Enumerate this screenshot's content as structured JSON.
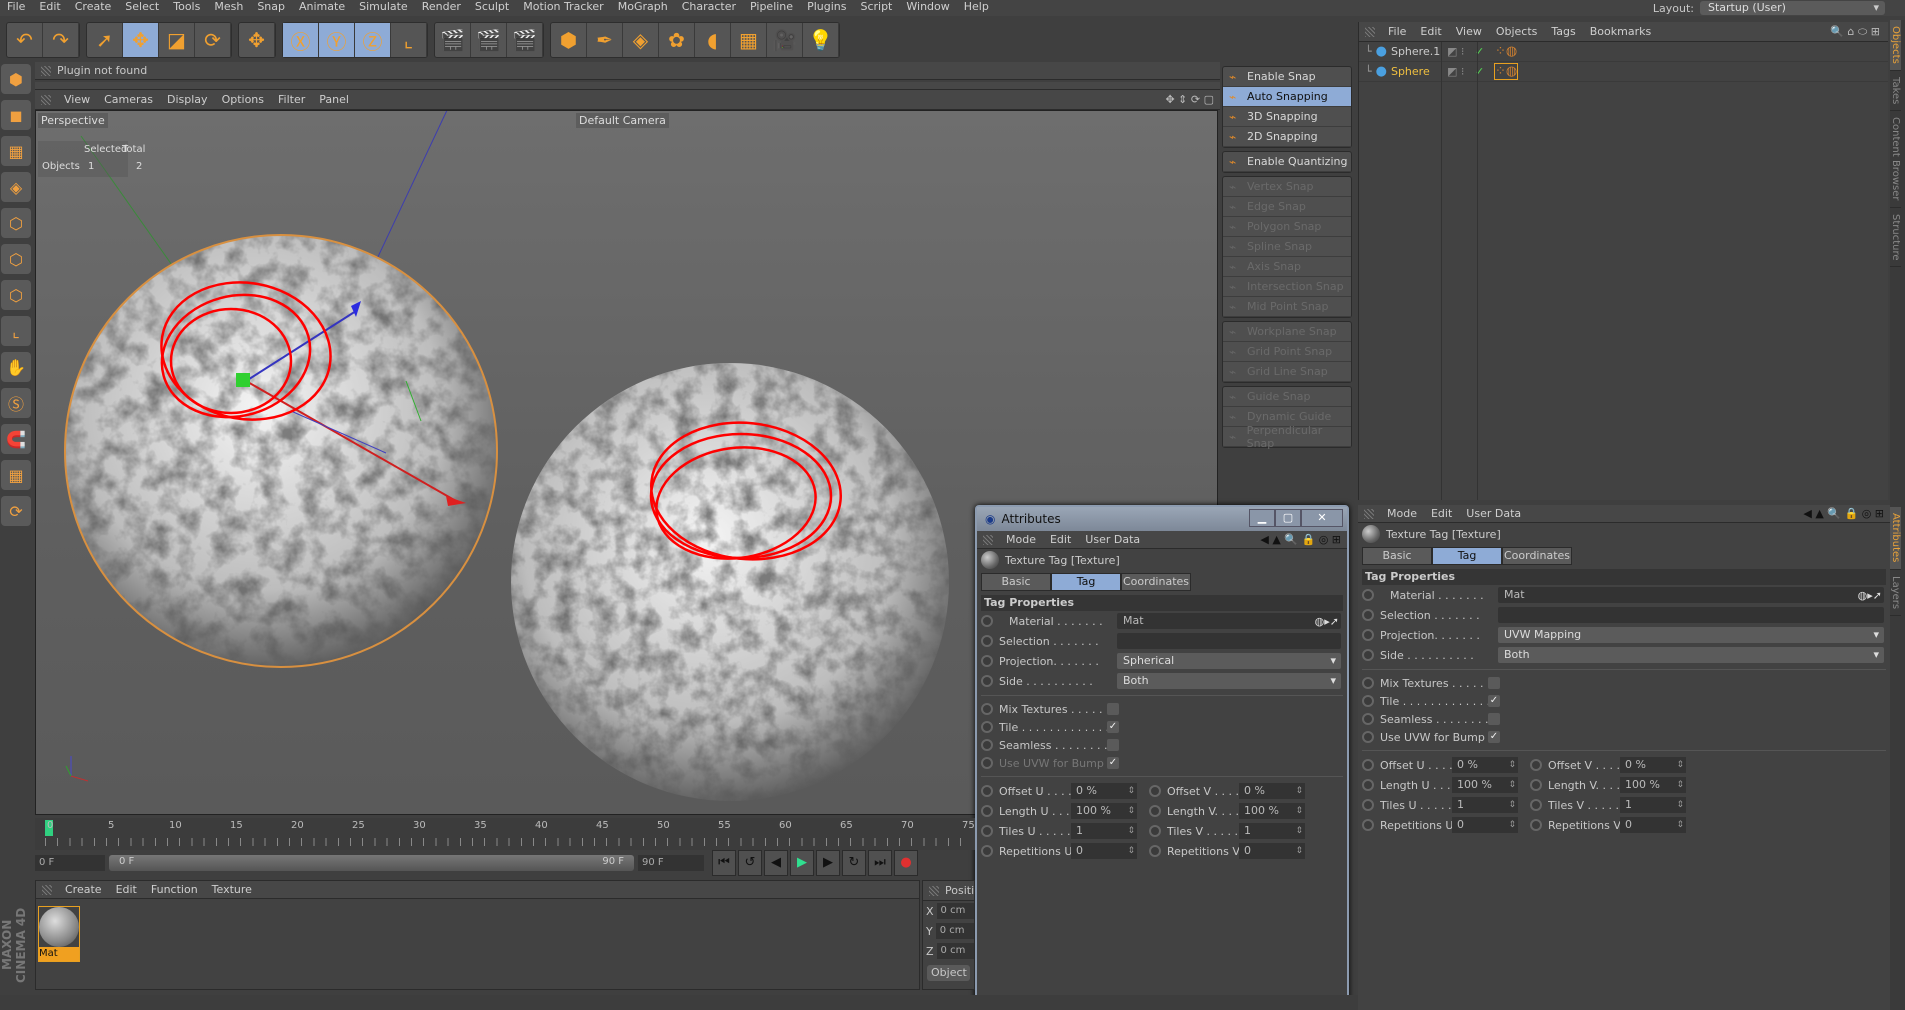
{
  "menu": [
    "File",
    "Edit",
    "Create",
    "Select",
    "Tools",
    "Mesh",
    "Snap",
    "Animate",
    "Simulate",
    "Render",
    "Sculpt",
    "Motion Tracker",
    "MoGraph",
    "Character",
    "Pipeline",
    "Plugins",
    "Script",
    "Window",
    "Help"
  ],
  "layout": {
    "label": "Layout:",
    "value": "Startup (User)"
  },
  "toolbar": [
    {
      "group": [
        {
          "icon": "undo-icon",
          "glyph": "↶"
        },
        {
          "icon": "redo-icon",
          "glyph": "↷"
        }
      ]
    },
    {
      "group": [
        {
          "icon": "live-selection-icon",
          "glyph": "➚"
        },
        {
          "icon": "move-icon",
          "glyph": "✥",
          "active": true
        },
        {
          "icon": "scale-icon",
          "glyph": "◪"
        },
        {
          "icon": "rotate-icon",
          "glyph": "⟳"
        }
      ]
    },
    {
      "group": [
        {
          "icon": "recent-tool-icon",
          "glyph": "✥"
        }
      ]
    },
    {
      "group": [
        {
          "icon": "x-axis-icon",
          "glyph": "Ⓧ",
          "active": true
        },
        {
          "icon": "y-axis-icon",
          "glyph": "Ⓨ",
          "active": true
        },
        {
          "icon": "z-axis-icon",
          "glyph": "Ⓩ",
          "active": true
        },
        {
          "icon": "coordinate-system-icon",
          "glyph": "⌞"
        }
      ]
    },
    {
      "group": [
        {
          "icon": "render-view-icon",
          "glyph": "🎬"
        },
        {
          "icon": "render-picture-viewer-icon",
          "glyph": "🎬"
        },
        {
          "icon": "render-settings-icon",
          "glyph": "🎬"
        }
      ]
    },
    {
      "group": [
        {
          "icon": "cube-icon",
          "glyph": "⬢"
        },
        {
          "icon": "pen-icon",
          "glyph": "✒"
        },
        {
          "icon": "subdivision-icon",
          "glyph": "◈"
        },
        {
          "icon": "cloner-icon",
          "glyph": "✿"
        },
        {
          "icon": "deformer-icon",
          "glyph": "◖"
        },
        {
          "icon": "floor-icon",
          "glyph": "▦"
        },
        {
          "icon": "camera-icon",
          "glyph": "🎥"
        },
        {
          "icon": "light-icon",
          "glyph": "💡"
        }
      ]
    }
  ],
  "left_tools": [
    "make-editable-icon",
    "model-mode-icon",
    "texture-mode-icon",
    "workplane-icon",
    "points-mode-icon",
    "edges-mode-icon",
    "polygons-mode-icon",
    "axis-mode-icon",
    "tweak-icon",
    "solo-icon",
    "snap-icon",
    "lock-workplane-icon",
    "quantize-icon"
  ],
  "status_bar": "Plugin not found",
  "viewport": {
    "menu": [
      "View",
      "Cameras",
      "Display",
      "Options",
      "Filter",
      "Panel"
    ],
    "view_name": "Perspective",
    "camera": "Default Camera",
    "hud": {
      "selected": "Selected",
      "total": "Total",
      "row_label": "Objects",
      "selected_value": "1",
      "total_value": "2"
    }
  },
  "snap_menu": [
    [
      {
        "label": "Enable Snap",
        "enabled": true
      },
      {
        "label": "Auto Snapping",
        "enabled": true,
        "highlight": true
      },
      {
        "label": "3D Snapping",
        "enabled": true
      },
      {
        "label": "2D Snapping",
        "enabled": true
      }
    ],
    [
      {
        "label": "Enable Quantizing",
        "enabled": true
      }
    ],
    [
      {
        "label": "Vertex Snap"
      },
      {
        "label": "Edge Snap"
      },
      {
        "label": "Polygon Snap"
      },
      {
        "label": "Spline Snap"
      },
      {
        "label": "Axis Snap"
      },
      {
        "label": "Intersection Snap"
      },
      {
        "label": "Mid Point Snap"
      }
    ],
    [
      {
        "label": "Workplane Snap"
      },
      {
        "label": "Grid Point Snap"
      },
      {
        "label": "Grid Line Snap"
      }
    ],
    [
      {
        "label": "Guide Snap"
      },
      {
        "label": "Dynamic Guide"
      },
      {
        "label": "Perpendicular Snap"
      }
    ]
  ],
  "object_manager": {
    "menu": [
      "File",
      "Edit",
      "View",
      "Objects",
      "Tags",
      "Bookmarks"
    ],
    "objects": [
      {
        "name": "Sphere.1",
        "selected": false
      },
      {
        "name": "Sphere",
        "selected": true
      }
    ]
  },
  "side_tabs_top": [
    "Objects",
    "Takes",
    "Content Browser",
    "Structure"
  ],
  "side_tabs_bottom": [
    "Attributes",
    "Layers"
  ],
  "attributes_floating": {
    "window_title": "Attributes",
    "menu": [
      "Mode",
      "Edit",
      "User Data"
    ],
    "object_title": "Texture Tag [Texture]",
    "tabs": [
      "Basic",
      "Tag",
      "Coordinates"
    ],
    "active_tab": "Tag",
    "section": "Tag Properties",
    "material": {
      "label": "Material . . . . . . .",
      "value": "Mat"
    },
    "selection": {
      "label": "Selection . . . . . . .",
      "value": ""
    },
    "projection": {
      "label": "Projection. . . . . . .",
      "value": "Spherical"
    },
    "side": {
      "label": "Side . . . . . . . . . .",
      "value": "Both"
    },
    "checks": [
      {
        "label": "Mix Textures . . . . .",
        "checked": false
      },
      {
        "label": "Tile . . . . . . . . . . . . .",
        "checked": true
      },
      {
        "label": "Seamless . . . . . . . .",
        "checked": false
      },
      {
        "label": "Use UVW for Bump",
        "checked": true,
        "disabled": true
      }
    ],
    "numeric": [
      [
        {
          "label": "Offset U . . . .",
          "value": "0 %"
        },
        {
          "label": "Offset V . . . .",
          "value": "0 %"
        }
      ],
      [
        {
          "label": "Length U . . .",
          "value": "100 %"
        },
        {
          "label": "Length V. . . .",
          "value": "100 %"
        }
      ],
      [
        {
          "label": "Tiles U . . . . .",
          "value": "1"
        },
        {
          "label": "Tiles V . . . . .",
          "value": "1"
        }
      ],
      [
        {
          "label": "Repetitions U",
          "value": "0"
        },
        {
          "label": "Repetitions V",
          "value": "0"
        }
      ]
    ]
  },
  "attributes_docked": {
    "menu": [
      "Mode",
      "Edit",
      "User Data"
    ],
    "object_title": "Texture Tag [Texture]",
    "tabs": [
      "Basic",
      "Tag",
      "Coordinates"
    ],
    "active_tab": "Tag",
    "section": "Tag Properties",
    "material": {
      "label": "Material . . . . . . .",
      "value": "Mat"
    },
    "selection": {
      "label": "Selection . . . . . . .",
      "value": ""
    },
    "projection": {
      "label": "Projection. . . . . . .",
      "value": "UVW Mapping"
    },
    "side": {
      "label": "Side . . . . . . . . . .",
      "value": "Both"
    },
    "checks": [
      {
        "label": "Mix Textures . . . . .",
        "checked": false
      },
      {
        "label": "Tile . . . . . . . . . . . . .",
        "checked": true
      },
      {
        "label": "Seamless . . . . . . . .",
        "checked": false
      },
      {
        "label": "Use UVW for Bump",
        "checked": true
      }
    ],
    "numeric": [
      [
        {
          "label": "Offset U . . . .",
          "value": "0 %"
        },
        {
          "label": "Offset V . . . .",
          "value": "0 %"
        }
      ],
      [
        {
          "label": "Length U . . .",
          "value": "100 %"
        },
        {
          "label": "Length V. . . .",
          "value": "100 %"
        }
      ],
      [
        {
          "label": "Tiles U . . . . .",
          "value": "1"
        },
        {
          "label": "Tiles V . . . . .",
          "value": "1"
        }
      ],
      [
        {
          "label": "Repetitions U",
          "value": "0"
        },
        {
          "label": "Repetitions V",
          "value": "0"
        }
      ]
    ]
  },
  "timeline": {
    "ticks": [
      "0",
      "5",
      "10",
      "15",
      "20",
      "25",
      "30",
      "35",
      "40",
      "45",
      "50",
      "55",
      "60",
      "65",
      "70",
      "75"
    ],
    "current_frame": "0 F",
    "range_start": "0 F",
    "range_end": "90 F",
    "end_frame": "90 F",
    "controls": [
      "go-to-start-icon",
      "previous-key-icon",
      "step-back-icon",
      "play-icon",
      "step-forward-icon",
      "next-key-icon",
      "go-to-end-icon",
      "record-icon"
    ]
  },
  "material_manager": {
    "menu": [
      "Create",
      "Edit",
      "Function",
      "Texture"
    ],
    "materials": [
      {
        "name": "Mat"
      }
    ]
  },
  "coordinates": {
    "title": "Position",
    "rows": [
      {
        "axis": "X",
        "value": "0 cm"
      },
      {
        "axis": "Y",
        "value": "0 cm"
      },
      {
        "axis": "Z",
        "value": "0 cm"
      }
    ],
    "button": "Object"
  },
  "brand": "MAXON CINEMA 4D",
  "colors": {
    "highlight": "#8eabd6",
    "selected_object": "#f0c040",
    "annotation": "#ff0000",
    "active_tab_side": "#e8a23a"
  }
}
